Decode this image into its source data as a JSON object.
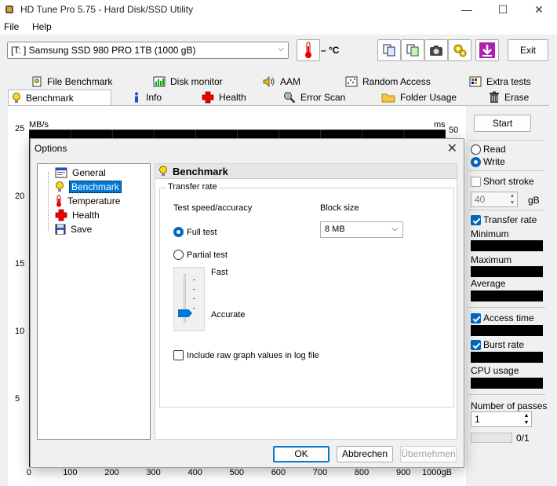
{
  "window": {
    "title": "HD Tune Pro 5.75 - Hard Disk/SSD Utility",
    "minimize": "—",
    "maximize": "☐",
    "close": "✕"
  },
  "menu": {
    "file": "File",
    "help": "Help"
  },
  "toolbar": {
    "drive": "[T: ] Samsung SSD 980 PRO 1TB (1000 gB)",
    "temperature": "– °C",
    "exit": "Exit"
  },
  "tabs": {
    "row1": [
      "File Benchmark",
      "Disk monitor",
      "AAM",
      "Random Access",
      "Extra tests"
    ],
    "row2": [
      "Benchmark",
      "Info",
      "Health",
      "Error Scan",
      "Folder Usage",
      "Erase"
    ]
  },
  "chart_data": {
    "type": "line",
    "series": [],
    "y_left_label": "MB/s",
    "y_right_label": "ms",
    "y_left_ticks": [
      "25",
      "20",
      "15",
      "10",
      "5"
    ],
    "y_right_top": "50",
    "x_ticks": [
      "0",
      "100",
      "200",
      "300",
      "400",
      "500",
      "600",
      "700",
      "800",
      "900",
      "1000gB"
    ],
    "ylim": [
      0,
      25
    ],
    "xlim": [
      0,
      1000
    ]
  },
  "right_panel": {
    "start": "Start",
    "read": "Read",
    "write": "Write",
    "short_stroke": "Short stroke",
    "short_stroke_value": "40",
    "short_stroke_unit": "gB",
    "transfer_rate": "Transfer rate",
    "minimum": "Minimum",
    "maximum": "Maximum",
    "average": "Average",
    "access_time": "Access time",
    "burst_rate": "Burst rate",
    "cpu_usage": "CPU usage",
    "number_of_passes": "Number of passes",
    "passes_value": "1",
    "pass_progress": "0/1"
  },
  "dialog": {
    "title": "Options",
    "tree": [
      "General",
      "Benchmark",
      "Temperature",
      "Health",
      "Save"
    ],
    "header": "Benchmark",
    "group_title": "Transfer rate",
    "test_speed_label": "Test speed/accuracy",
    "block_size_label": "Block size",
    "full_test": "Full test",
    "partial_test": "Partial test",
    "block_size_value": "8 MB",
    "fast": "Fast",
    "accurate": "Accurate",
    "raw_graph": "Include raw graph values in log file",
    "ok": "OK",
    "cancel": "Abbrechen",
    "apply": "Übernehmen"
  }
}
